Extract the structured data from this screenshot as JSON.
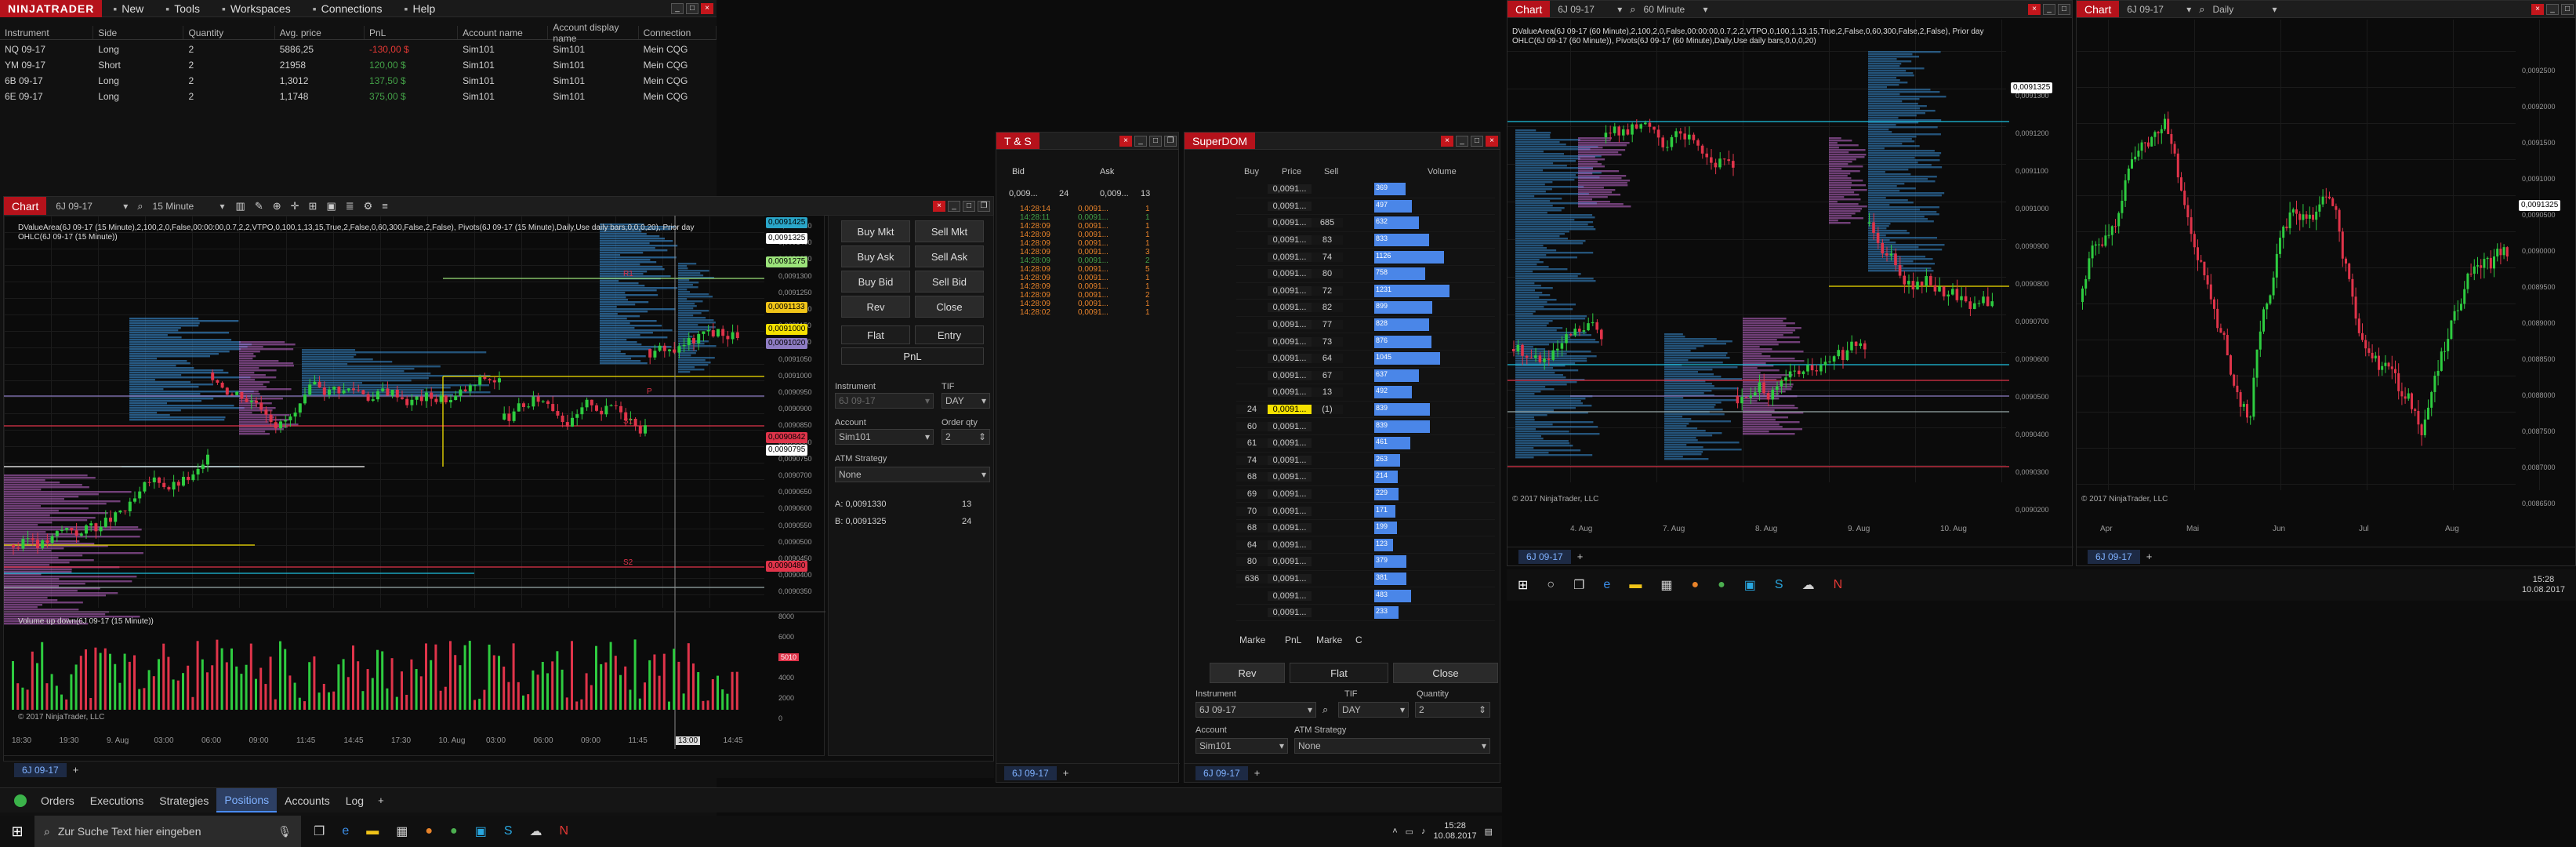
{
  "app": {
    "logo": "NINJATRADER"
  },
  "menu": [
    {
      "label": "New",
      "icon": "new-icon"
    },
    {
      "label": "Tools",
      "icon": "tools-icon"
    },
    {
      "label": "Workspaces",
      "icon": "workspace-icon"
    },
    {
      "label": "Connections",
      "icon": "connections-icon"
    },
    {
      "label": "Help",
      "icon": "help-icon"
    }
  ],
  "positions": {
    "columns": [
      "Instrument",
      "Side",
      "Quantity",
      "Avg. price",
      "PnL",
      "Account name",
      "Account display name",
      "Connection"
    ],
    "rows": [
      {
        "instrument": "NQ 09-17",
        "side": "Long",
        "qty": "2",
        "avg": "5886,25",
        "pnl": "-130,00 $",
        "pnl_color": "#e53935",
        "account": "Sim101",
        "display": "Sim101",
        "conn": "Mein CQG"
      },
      {
        "instrument": "YM 09-17",
        "side": "Short",
        "qty": "2",
        "avg": "21958",
        "pnl": "120,00 $",
        "pnl_color": "#43a047",
        "account": "Sim101",
        "display": "Sim101",
        "conn": "Mein CQG"
      },
      {
        "instrument": "6B 09-17",
        "side": "Long",
        "qty": "2",
        "avg": "1,3012",
        "pnl": "137,50 $",
        "pnl_color": "#43a047",
        "account": "Sim101",
        "display": "Sim101",
        "conn": "Mein CQG"
      },
      {
        "instrument": "6E 09-17",
        "side": "Long",
        "qty": "2",
        "avg": "1,1748",
        "pnl": "375,00 $",
        "pnl_color": "#43a047",
        "account": "Sim101",
        "display": "Sim101",
        "conn": "Mein CQG"
      }
    ]
  },
  "chart_main": {
    "tab": "Chart",
    "instrument": "6J 09-17",
    "interval": "15 Minute",
    "indicator_line1": "DValueArea(6J 09-17 (15 Minute),2,100,2,0,False,00:00:00,0.7,2,2,VTPO,0,100,1,13,15,True,2,False,0,60,300,False,2,False), Pivots(6J 09-17 (15 Minute),Daily,Use daily bars,0,0,0,20), Prior day",
    "indicator_line2": "OHLC(6J 09-17 (15 Minute))",
    "volume_label": "Volume up down(6J 09-17 (15 Minute))",
    "copyright": "© 2017 NinjaTrader, LLC",
    "price_labels": [
      "0,0091450",
      "0,0091400",
      "0,0091350",
      "0,0091300",
      "0,0091250",
      "0,0091200",
      "0,0091150",
      "0,0091100",
      "0,0091050",
      "0,0091000",
      "0,0090950",
      "0,0090900",
      "0,0090850",
      "0,0090800",
      "0,0090750",
      "0,0090700",
      "0,0090650",
      "0,0090600",
      "0,0090550",
      "0,0090500",
      "0,0090450",
      "0,0090400",
      "0,0090350"
    ],
    "badges": [
      {
        "text": "0,0091425",
        "color": "#2aa6c9"
      },
      {
        "text": "0,0091325",
        "color": "#ffffff"
      },
      {
        "text": "0,0091275",
        "color": "#9be37a"
      },
      {
        "text": "0,0091133",
        "color": "#f0c419"
      },
      {
        "text": "0,0091000",
        "color": "#f5e100"
      },
      {
        "text": "0,0091020",
        "color": "#8e7cc3"
      },
      {
        "text": "0,0090842",
        "color": "#e0344a"
      },
      {
        "text": "0,0090795",
        "color": "#ffffff"
      },
      {
        "text": "0,0090480",
        "color": "#e0344a"
      }
    ],
    "volume_labels": [
      "8000",
      "6000",
      "5010",
      "4000",
      "2000",
      "0"
    ],
    "time_labels": [
      "18:30",
      "19:30",
      "9. Aug",
      "03:00",
      "06:00",
      "09:00",
      "11:45",
      "14:45",
      "17:30",
      "10. Aug",
      "03:00",
      "06:00",
      "09:00",
      "11:45",
      "13:00",
      "14:45"
    ],
    "levels": [
      "S1",
      "S2",
      "P",
      "R1"
    ],
    "footer_tab": "6J 09-17"
  },
  "order_panel": {
    "buy_mkt": "Buy Mkt",
    "sell_mkt": "Sell Mkt",
    "buy_ask": "Buy Ask",
    "sell_ask": "Sell Ask",
    "buy_bid": "Buy Bid",
    "sell_bid": "Sell Bid",
    "rev": "Rev",
    "close": "Close",
    "flat": "Flat",
    "entry": "Entry",
    "pnl": "PnL",
    "instrument_label": "Instrument",
    "tif_label": "TIF",
    "instrument_value": "6J 09-17",
    "tif_value": "DAY",
    "account_label": "Account",
    "qty_label": "Order qty",
    "account_value": "Sim101",
    "qty_value": "2",
    "atm_label": "ATM Strategy",
    "atm_value": "None",
    "ask_line": "A: 0,0091330",
    "ask_qty": "13",
    "bid_line": "B: 0,0091325",
    "bid_qty": "24"
  },
  "ts": {
    "title": "T & S",
    "bid_label": "Bid",
    "ask_label": "Ask",
    "bid_price": "0,009...",
    "bid_size": "24",
    "ask_price": "0,009...",
    "ask_size": "13",
    "rows": [
      {
        "time": "14:28:14",
        "price": "0,0091...",
        "size": "1",
        "color": "#e8832a"
      },
      {
        "time": "14:28:11",
        "price": "0,0091...",
        "size": "1",
        "color": "#43a047"
      },
      {
        "time": "14:28:09",
        "price": "0,0091...",
        "size": "1",
        "color": "#e8832a"
      },
      {
        "time": "14:28:09",
        "price": "0,0091...",
        "size": "1",
        "color": "#e8832a"
      },
      {
        "time": "14:28:09",
        "price": "0,0091...",
        "size": "1",
        "color": "#e8832a"
      },
      {
        "time": "14:28:09",
        "price": "0,0091...",
        "size": "3",
        "color": "#e8832a"
      },
      {
        "time": "14:28:09",
        "price": "0,0091...",
        "size": "2",
        "color": "#43a047"
      },
      {
        "time": "14:28:09",
        "price": "0,0091...",
        "size": "5",
        "color": "#e8832a"
      },
      {
        "time": "14:28:09",
        "price": "0,0091...",
        "size": "1",
        "color": "#e8832a"
      },
      {
        "time": "14:28:09",
        "price": "0,0091...",
        "size": "1",
        "color": "#e8832a"
      },
      {
        "time": "14:28:09",
        "price": "0,0091...",
        "size": "2",
        "color": "#e8832a"
      },
      {
        "time": "14:28:09",
        "price": "0,0091...",
        "size": "1",
        "color": "#e8832a"
      },
      {
        "time": "14:28:02",
        "price": "0,0091...",
        "size": "1",
        "color": "#e8832a"
      }
    ],
    "footer_tab": "6J 09-17"
  },
  "superdom": {
    "title": "SuperDOM",
    "cols": {
      "buy": "Buy",
      "price": "Price",
      "sell": "Sell",
      "volume": "Volume"
    },
    "rows": [
      {
        "buy": "",
        "price": "0,0091...",
        "sell": "",
        "vol": "369"
      },
      {
        "buy": "",
        "price": "0,0091...",
        "sell": "",
        "vol": "497"
      },
      {
        "buy": "",
        "price": "0,0091...",
        "sell": "685",
        "vol": "632"
      },
      {
        "buy": "",
        "price": "0,0091...",
        "sell": "83",
        "vol": "833"
      },
      {
        "buy": "",
        "price": "0,0091...",
        "sell": "74",
        "vol": "1126"
      },
      {
        "buy": "",
        "price": "0,0091...",
        "sell": "80",
        "vol": "758"
      },
      {
        "buy": "",
        "price": "0,0091...",
        "sell": "72",
        "vol": "1231"
      },
      {
        "buy": "",
        "price": "0,0091...",
        "sell": "82",
        "vol": "899"
      },
      {
        "buy": "",
        "price": "0,0091...",
        "sell": "77",
        "vol": "828"
      },
      {
        "buy": "",
        "price": "0,0091...",
        "sell": "73",
        "vol": "876"
      },
      {
        "buy": "",
        "price": "0,0091...",
        "sell": "64",
        "vol": "1045"
      },
      {
        "buy": "",
        "price": "0,0091...",
        "sell": "67",
        "vol": "637"
      },
      {
        "buy": "",
        "price": "0,0091...",
        "sell": "13",
        "vol": "492"
      },
      {
        "buy": "24",
        "price": "0,0091...",
        "sell": "(1)",
        "vol": "839"
      },
      {
        "buy": "60",
        "price": "0,0091...",
        "sell": "",
        "vol": "839"
      },
      {
        "buy": "61",
        "price": "0,0091...",
        "sell": "",
        "vol": "461"
      },
      {
        "buy": "74",
        "price": "0,0091...",
        "sell": "",
        "vol": "263"
      },
      {
        "buy": "68",
        "price": "0,0091...",
        "sell": "",
        "vol": "214"
      },
      {
        "buy": "69",
        "price": "0,0091...",
        "sell": "",
        "vol": "229"
      },
      {
        "buy": "70",
        "price": "0,0091...",
        "sell": "",
        "vol": "171"
      },
      {
        "buy": "68",
        "price": "0,0091...",
        "sell": "",
        "vol": "199"
      },
      {
        "buy": "64",
        "price": "0,0091...",
        "sell": "",
        "vol": "123"
      },
      {
        "buy": "80",
        "price": "0,0091...",
        "sell": "",
        "vol": "379"
      },
      {
        "buy": "636",
        "price": "0,0091...",
        "sell": "",
        "vol": "381"
      },
      {
        "buy": "",
        "price": "0,0091...",
        "sell": "",
        "vol": "483"
      },
      {
        "buy": "",
        "price": "0,0091...",
        "sell": "",
        "vol": "233"
      }
    ],
    "marker_left": "Marke",
    "pnl": "PnL",
    "marker_right": "Marke",
    "c": "C",
    "rev": "Rev",
    "flat": "Flat",
    "close": "Close",
    "instrument_label": "Instrument",
    "tif_label": "TIF",
    "qty_label": "Quantity",
    "instrument_value": "6J 09-17",
    "tif_value": "DAY",
    "qty_value": "2",
    "account_label": "Account",
    "atm_label": "ATM Strategy",
    "account_value": "Sim101",
    "atm_value": "None",
    "footer_tab": "6J 09-17"
  },
  "chart_60": {
    "tab": "Chart",
    "instrument": "6J 09-17",
    "interval": "60 Minute",
    "indicator_line1": "DValueArea(6J 09-17 (60 Minute),2,100,2,0,False,00:00:00,0.7,2,2,VTPO,0,100,1,13,15,True,2,False,0,60,300,False,2,False), Prior day",
    "indicator_line2": "OHLC(6J 09-17 (60 Minute)), Pivots(6J 09-17 (60 Minute),Daily,Use daily bars,0,0,0,20)",
    "copyright": "© 2017 NinjaTrader, LLC",
    "price_labels": [
      "0,0091300",
      "0,0091200",
      "0,0091100",
      "0,0091000",
      "0,0090900",
      "0,0090800",
      "0,0090700",
      "0,0090600",
      "0,0090500",
      "0,0090400",
      "0,0090300",
      "0,0090200"
    ],
    "current": "0,0091325",
    "time_labels": [
      "4. Aug",
      "7. Aug",
      "8. Aug",
      "9. Aug",
      "10. Aug"
    ],
    "footer_tab": "6J 09-17"
  },
  "chart_daily": {
    "tab": "Chart",
    "instrument": "6J 09-17",
    "interval": "Daily",
    "copyright": "© 2017 NinjaTrader, LLC",
    "price_labels": [
      "0,0092500",
      "0,0092000",
      "0,0091500",
      "0,0091000",
      "0,0090500",
      "0,0090000",
      "0,0089500",
      "0,0089000",
      "0,0088500",
      "0,0088000",
      "0,0087500",
      "0,0087000",
      "0,0086500"
    ],
    "current": "0,0091325",
    "time_labels": [
      "Apr",
      "Mai",
      "Jun",
      "Jul",
      "Aug"
    ],
    "footer_tab": "6J 09-17"
  },
  "bottom_tabs": [
    "Orders",
    "Executions",
    "Strategies",
    "Positions",
    "Accounts",
    "Log"
  ],
  "taskbar": {
    "search": "Zur Suche Text hier eingeben",
    "time": "15:28",
    "date": "10.08.2017"
  }
}
